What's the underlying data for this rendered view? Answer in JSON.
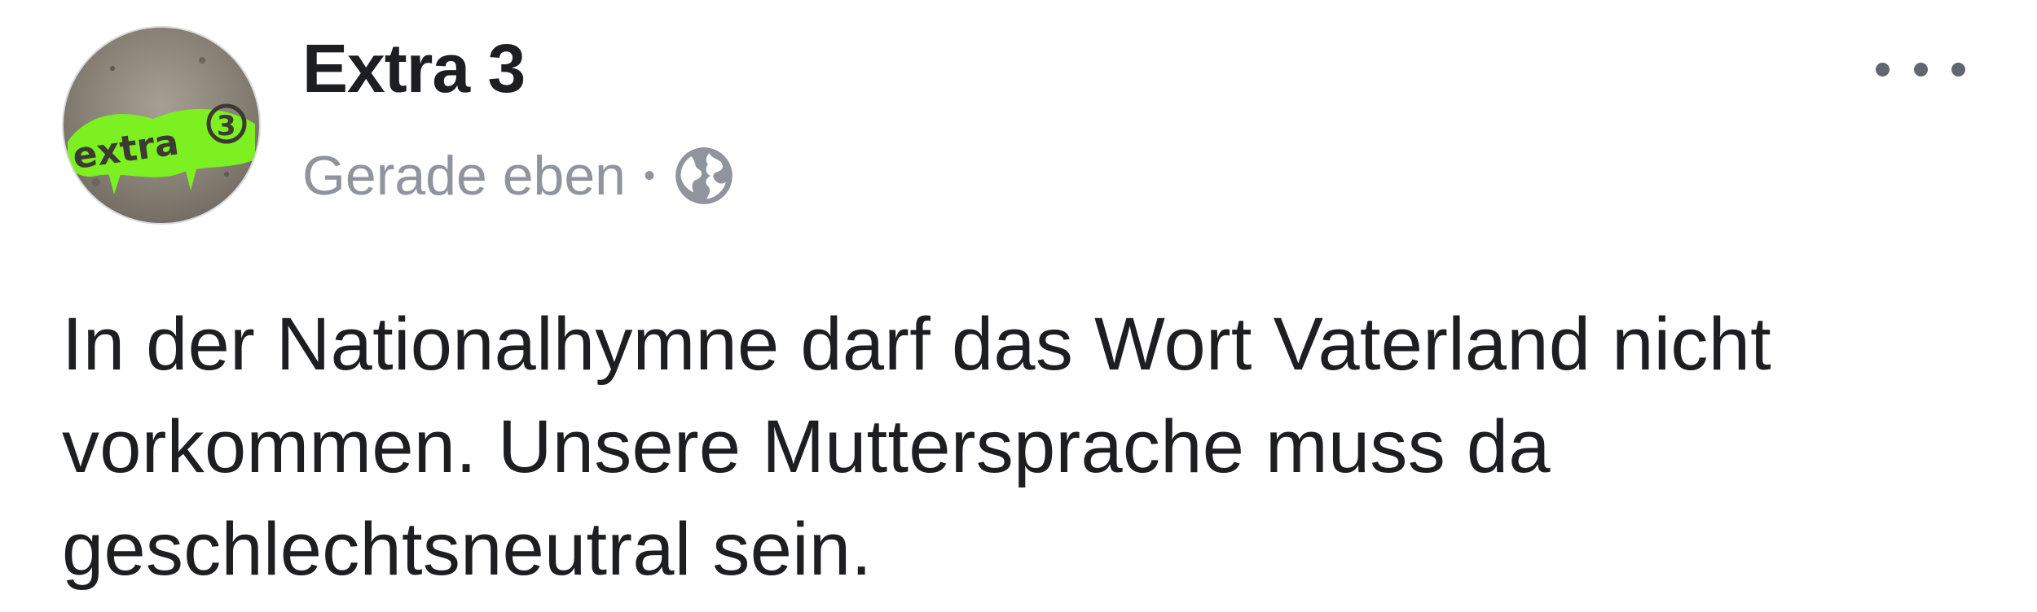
{
  "post": {
    "author": {
      "name": "Extra 3",
      "avatar_text": "extra3"
    },
    "timestamp": "Gerade eben",
    "separator": "•",
    "privacy_icon": "globe-icon",
    "options_icon": "more-options-icon",
    "text_lines": [
      "In der Nationalhymne darf das Wort Vaterland nicht",
      "vorkommen. Unsere Muttersprache muss da",
      "geschlechtsneutral sein."
    ]
  },
  "colors": {
    "name_text": "#1c1e21",
    "meta_text": "#90949c",
    "body_text": "#1c1e21",
    "avatar_green": "#7cf021",
    "avatar_bg": "#8a847a"
  }
}
